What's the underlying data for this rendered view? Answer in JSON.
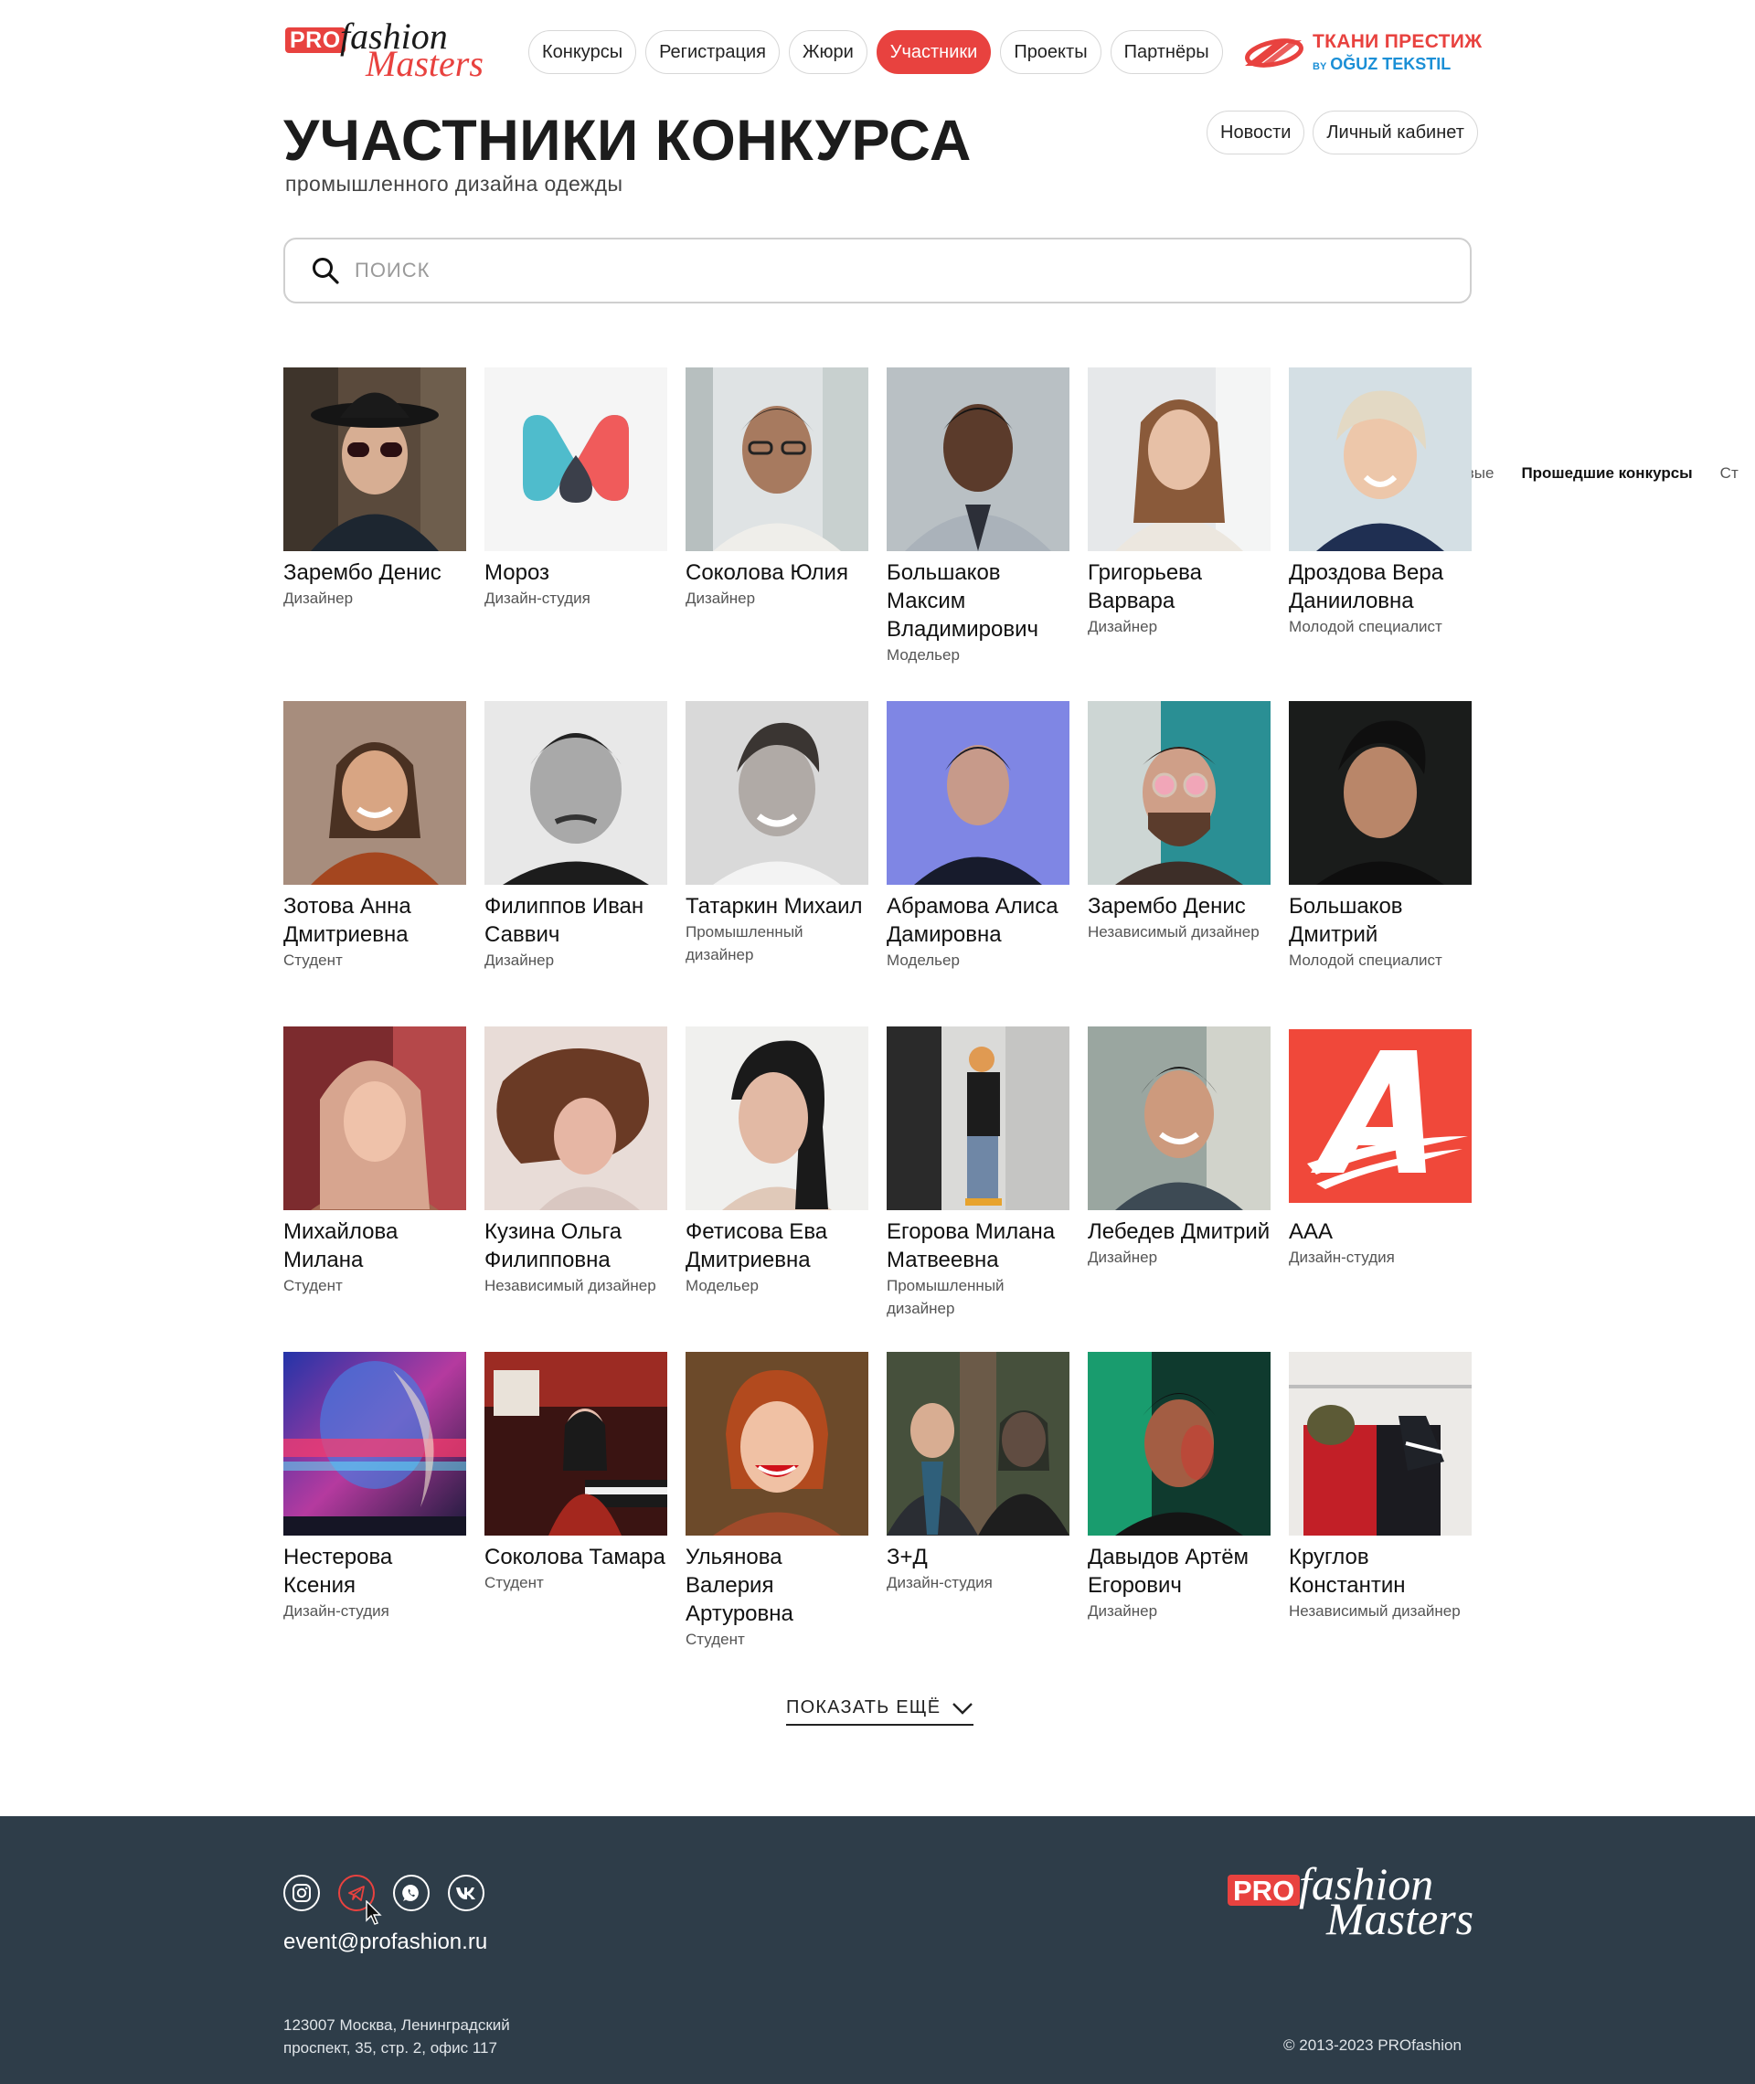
{
  "header": {
    "logo": {
      "pro": "PRO",
      "fashion": "fashion",
      "masters": "Masters"
    },
    "nav": [
      {
        "label": "Конкурсы",
        "active": false
      },
      {
        "label": "Регистрация",
        "active": false
      },
      {
        "label": "Жюри",
        "active": false
      },
      {
        "label": "Участники",
        "active": true
      },
      {
        "label": "Проекты",
        "active": false
      },
      {
        "label": "Партнёры",
        "active": false
      }
    ],
    "partner": {
      "line1": "ТКАНИ ПРЕСТИЖ",
      "by": "BY",
      "line2": "OĞUZ TEKSTIL"
    },
    "secondary_nav": [
      "Новости",
      "Личный кабинет"
    ]
  },
  "page": {
    "title": "УЧАСТНИКИ КОНКУРСА",
    "subtitle": "промышленного дизайна одежды"
  },
  "search": {
    "placeholder": "ПОИСК",
    "value": ""
  },
  "side_filter": {
    "new": "Новые",
    "past": "Прошедшие конкурсы",
    "more": "Ст"
  },
  "participants": [
    {
      "name": "Зарембо Денис",
      "role": "Дизайнер"
    },
    {
      "name": "Мороз",
      "role": "Дизайн-студия"
    },
    {
      "name": "Соколова Юлия",
      "role": "Дизайнер"
    },
    {
      "name": "Большаков Максим Владимирович",
      "role": "Модельер"
    },
    {
      "name": "Григорьева Варвара",
      "role": "Дизайнер"
    },
    {
      "name": "Дроздова Вера Данииловна",
      "role": "Молодой специалист"
    },
    {
      "name": "Зотова Анна Дмитриевна",
      "role": "Студент"
    },
    {
      "name": "Филиппов Иван Саввич",
      "role": "Дизайнер"
    },
    {
      "name": "Татаркин Михаил",
      "role": "Промышленный дизайнер"
    },
    {
      "name": "Абрамова Алиса Дамировна",
      "role": "Модельер"
    },
    {
      "name": "Зарембо Денис",
      "role": "Независимый дизайнер"
    },
    {
      "name": "Большаков Дмитрий",
      "role": "Молодой специалист"
    },
    {
      "name": "Михайлова Милана",
      "role": "Студент"
    },
    {
      "name": "Кузина Ольга Филипповна",
      "role": "Независимый дизайнер"
    },
    {
      "name": "Фетисова Ева Дмитриевна",
      "role": "Модельер"
    },
    {
      "name": "Егорова Милана Матвеевна",
      "role": "Промышленный дизайнер"
    },
    {
      "name": "Лебедев Дмитрий",
      "role": "Дизайнер"
    },
    {
      "name": "ААА",
      "role": "Дизайн-студия"
    },
    {
      "name": "Нестерова Ксения",
      "role": "Дизайн-студия"
    },
    {
      "name": "Соколова Тамара",
      "role": "Студент"
    },
    {
      "name": "Ульянова Валерия Артуровна",
      "role": "Студент"
    },
    {
      "name": "З+Д",
      "role": "Дизайн-студия"
    },
    {
      "name": "Давыдов Артём Егорович",
      "role": "Дизайнер"
    },
    {
      "name": "Круглов Константин",
      "role": "Независимый дизайнер"
    }
  ],
  "show_more": "ПОКАЗАТЬ ЕЩЁ",
  "footer": {
    "socials": [
      "instagram-icon",
      "telegram-icon",
      "whatsapp-icon",
      "vk-icon"
    ],
    "email": "event@profashion.ru",
    "address": "123007 Москва, Ленинградский проспект, 35, стр. 2, офис 117",
    "copyright": "© 2013-2023 PROfashion",
    "logo": {
      "pro": "PRO",
      "fashion": "fashion",
      "masters": "Masters"
    }
  },
  "colors": {
    "accent": "#e8423f",
    "footer_bg": "#2e3d49",
    "partner_blue": "#1b8fd6"
  }
}
